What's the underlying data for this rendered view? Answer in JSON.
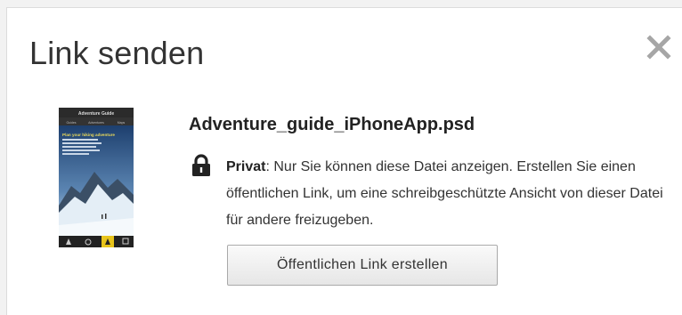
{
  "dialog": {
    "title": "Link senden",
    "close_icon": "close-icon"
  },
  "file": {
    "name": "Adventure_guide_iPhoneApp.psd",
    "thumbnail": {
      "app_title": "Adventure Guide",
      "tabs": [
        "Guides",
        "Adventures",
        "Maps"
      ],
      "headline": "Plan your hiking adventure"
    }
  },
  "privacy": {
    "icon": "lock-icon",
    "label": "Privat",
    "text": ": Nur Sie können diese Datei anzeigen. Erstellen Sie einen öffentlichen Link, um eine schreibgeschützte Ansicht von dieser Datei für andere freizugeben."
  },
  "actions": {
    "create_link_label": "Öffentlichen Link erstellen"
  }
}
